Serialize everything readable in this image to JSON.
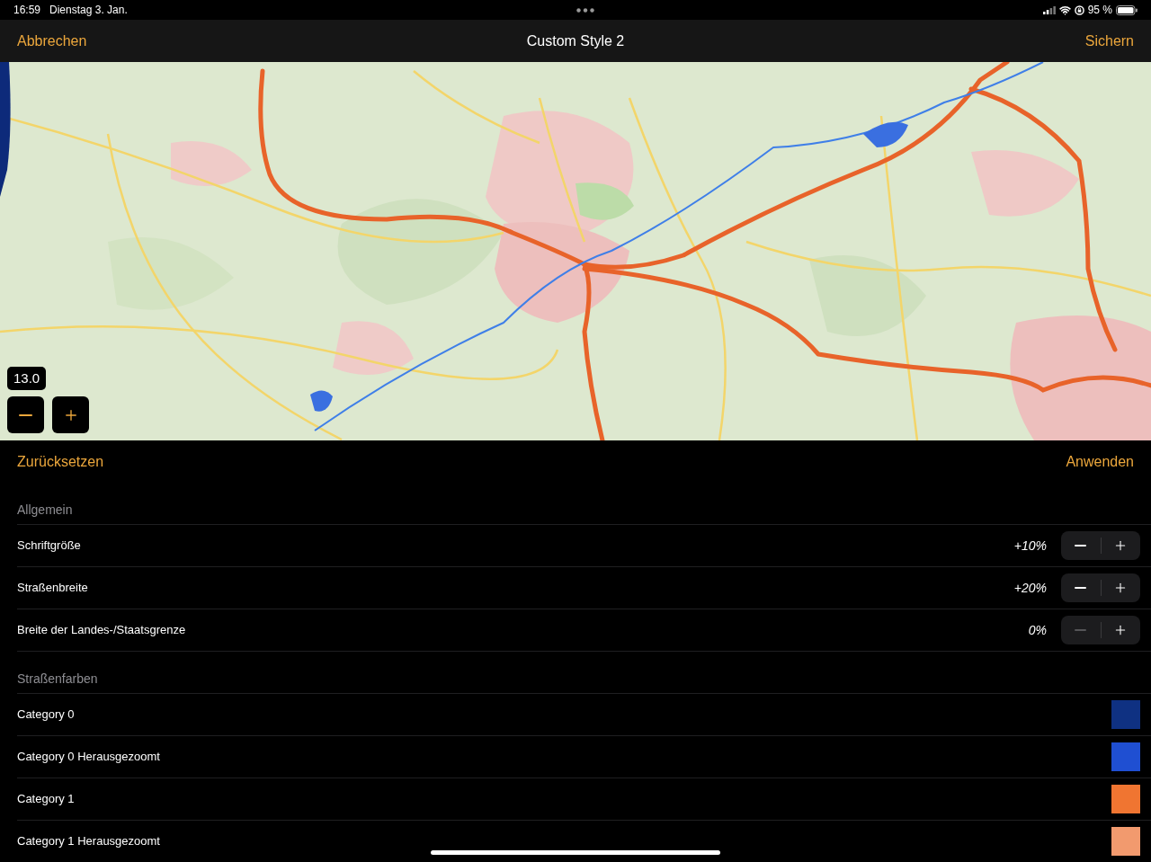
{
  "status_bar": {
    "time": "16:59",
    "date": "Dienstag 3. Jan.",
    "battery": "95 %"
  },
  "nav_bar": {
    "cancel": "Abbrechen",
    "title": "Custom Style 2",
    "save": "Sichern"
  },
  "map": {
    "zoom_level": "13.0"
  },
  "actions": {
    "reset": "Zurücksetzen",
    "apply": "Anwenden"
  },
  "sections": [
    {
      "title": "Allgemein",
      "rows": [
        {
          "kind": "stepper",
          "label": "Schriftgröße",
          "value": "+10%",
          "minus_disabled": false
        },
        {
          "kind": "stepper",
          "label": "Straßenbreite",
          "value": "+20%",
          "minus_disabled": false
        },
        {
          "kind": "stepper",
          "label": "Breite der Landes-/Staatsgrenze",
          "value": "0%",
          "minus_disabled": true
        }
      ]
    },
    {
      "title": "Straßenfarben",
      "rows": [
        {
          "kind": "color",
          "label": "Category 0",
          "color": "#0f3182"
        },
        {
          "kind": "color",
          "label": "Category 0 Herausgezoomt",
          "color": "#1f4fd2"
        },
        {
          "kind": "color",
          "label": "Category 1",
          "color": "#f07531"
        },
        {
          "kind": "color",
          "label": "Category 1 Herausgezoomt",
          "color": "#f29a6e"
        }
      ]
    }
  ]
}
